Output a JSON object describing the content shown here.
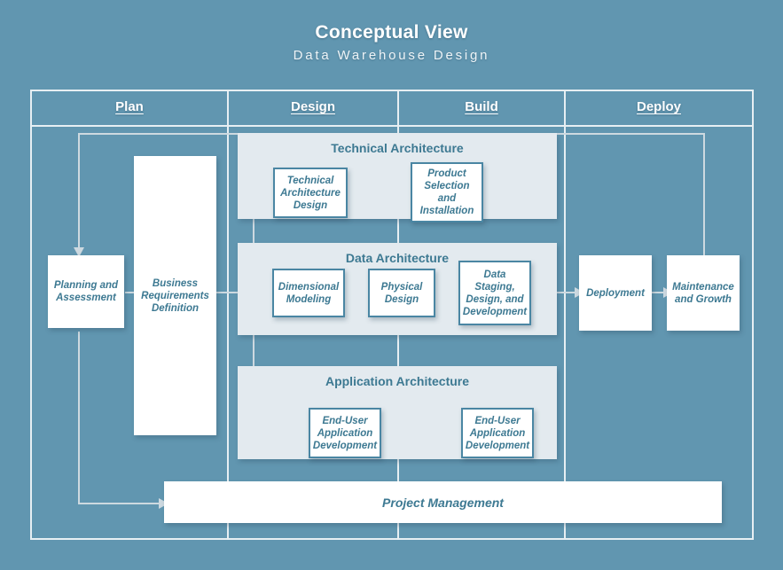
{
  "title": {
    "main": "Conceptual View",
    "sub": "Data Warehouse Design"
  },
  "colors": {
    "background": "#6196b0",
    "frame": "#e7eff3",
    "band_fill": "#e3eaef",
    "node_fill": "#ffffff",
    "node_border": "#4a86a3",
    "text_accent": "#3d7992",
    "connector": "#cdd9e0"
  },
  "columns": [
    {
      "label": "Plan"
    },
    {
      "label": "Design"
    },
    {
      "label": "Build"
    },
    {
      "label": "Deploy"
    }
  ],
  "bands": [
    {
      "title": "Technical Architecture"
    },
    {
      "title": "Data Architecture"
    },
    {
      "title": "Application Architecture"
    }
  ],
  "nodes": {
    "planning": "Planning and Assessment",
    "business_requirements": "Business Requirements Definition",
    "technical_architecture_design": "Technical Architecture Design",
    "product_selection": "Product Selection and Installation",
    "dimensional_modeling": "Dimensional Modeling",
    "physical_design": "Physical Design",
    "data_staging": "Data Staging, Design, and Development",
    "end_user_app_dev_1": "End-User Application Development",
    "end_user_app_dev_2": "End-User Application Development",
    "deployment": "Deployment",
    "maintenance": "Maintenance and Growth",
    "project_management": "Project Management"
  }
}
